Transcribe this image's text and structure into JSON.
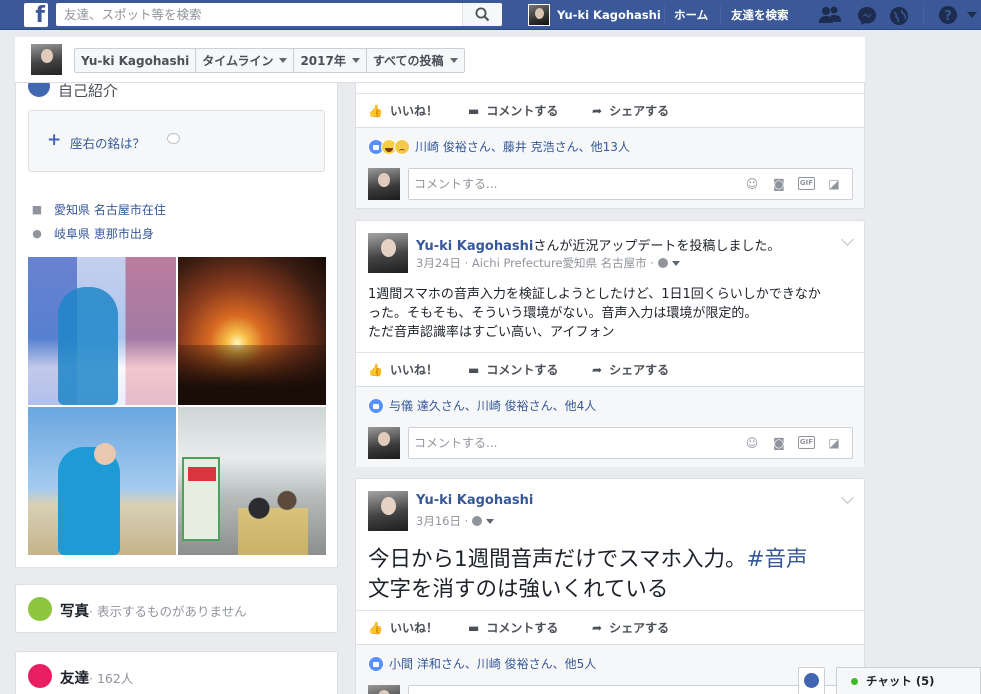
{
  "topbar": {
    "logo": "f",
    "search_placeholder": "友達、スポット等を検索",
    "profile_name": "Yu-ki Kagohashi",
    "home": "ホーム",
    "find_friends": "友達を検索",
    "help": "?"
  },
  "subheader": {
    "name": "Yu-ki Kagohashi",
    "timeline": "タイムライン",
    "year": "2017年",
    "filter": "すべての投稿"
  },
  "intro": {
    "title": "自己紹介",
    "motto_add": "座右の銘は？",
    "lives": "愛知県 名古屋市在住",
    "from": "岐阜県 恵那市出身"
  },
  "photos_card": {
    "title": "写真",
    "empty": "· 表示するものがありません"
  },
  "friends_card": {
    "title": "友達",
    "count": "· 162人"
  },
  "actions": {
    "like": "いいね！",
    "comment": "コメントする",
    "share": "シェアする"
  },
  "comment_placeholder": "コメントする...",
  "posts": [
    {
      "likes": "川崎 俊裕さん、藤井 克浩さん、他13人"
    },
    {
      "author": "Yu-ki Kagohashi",
      "activity": "さんが近況アップデートを投稿しました。",
      "meta": "3月24日 · Aichi Prefecture愛知県 名古屋市 ·",
      "body_1": "1週間スマホの音声入力を検証しようとしたけど、1日1回くらいしかできなか",
      "body_2": "った。そもそも、そういう環境がない。音声入力は環境が限定的。",
      "body_3": "ただ音声認識率はすごい高い、アイフォン",
      "likes": "与儀 達久さん、川崎 俊裕さん、他4人"
    },
    {
      "author": "Yu-ki Kagohashi",
      "meta": "3月16日 ·",
      "big_1": "今日から1週間音声だけでスマホ入力。",
      "hashtag": "#音声",
      "big_2": "文字を消すのは強いくれている",
      "likes": "小間 洋和さん、川崎 俊裕さん、他5人"
    }
  ],
  "chat": {
    "label": "チャット (5)"
  },
  "colors": {
    "brand": "#3b5998",
    "link": "#365899",
    "online": "#42b72a"
  }
}
